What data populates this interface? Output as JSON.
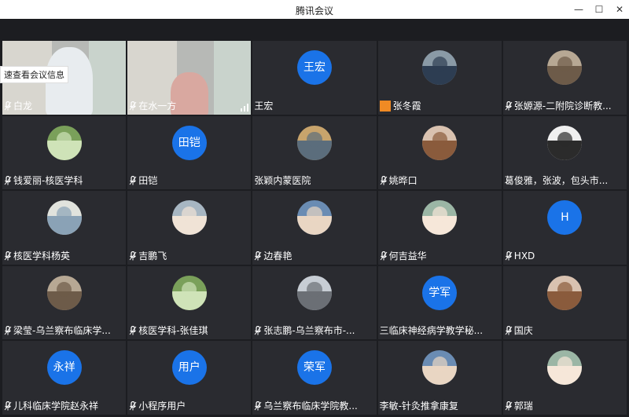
{
  "window": {
    "title": "腾讯会议",
    "min_glyph": "—",
    "max_glyph": "☐",
    "close_glyph": "✕"
  },
  "tooltip": "速查看会议信息",
  "colors": {
    "avatar_blue": "#1a73e8",
    "tile_bg": "#2a2b30",
    "grid_bg": "#1c1d21"
  },
  "participants": [
    {
      "name": "白龙",
      "icon": "mic-icon",
      "kind": "video"
    },
    {
      "name": "在水一方",
      "icon": "mic-icon",
      "kind": "video"
    },
    {
      "name": "王宏",
      "icon": "",
      "kind": "text",
      "avatar_text": "王宏"
    },
    {
      "name": "张冬霞",
      "icon": "person-icon",
      "kind": "photo"
    },
    {
      "name": "张嫄源-二附院诊断教...",
      "icon": "mic-icon",
      "kind": "photo"
    },
    {
      "name": "钱爱丽-核医学科",
      "icon": "mic-icon",
      "kind": "photo"
    },
    {
      "name": "田铠",
      "icon": "mic-icon",
      "kind": "text",
      "avatar_text": "田铠"
    },
    {
      "name": "张颖内蒙医院",
      "icon": "",
      "kind": "photo"
    },
    {
      "name": "姚晔口",
      "icon": "mic-icon",
      "kind": "photo"
    },
    {
      "name": "葛俊雅，张波，包头市...",
      "icon": "",
      "kind": "photo"
    },
    {
      "name": "核医学科杨英",
      "icon": "mic-icon",
      "kind": "photo"
    },
    {
      "name": "吉鹏飞",
      "icon": "mic-icon",
      "kind": "photo"
    },
    {
      "name": "边春艳",
      "icon": "mic-icon",
      "kind": "photo"
    },
    {
      "name": "何吉益华",
      "icon": "mic-icon",
      "kind": "photo"
    },
    {
      "name": "HXD",
      "icon": "mic-icon",
      "kind": "text",
      "avatar_text": "H"
    },
    {
      "name": "梁莹-乌兰察布临床学...",
      "icon": "mic-icon",
      "kind": "photo"
    },
    {
      "name": "核医学科-张佳琪",
      "icon": "mic-icon",
      "kind": "photo"
    },
    {
      "name": "张志鹏-乌兰察布市-...",
      "icon": "mic-icon",
      "kind": "photo"
    },
    {
      "name": "三临床神经病学教学秘...",
      "icon": "",
      "kind": "text",
      "avatar_text": "学军"
    },
    {
      "name": "国庆",
      "icon": "mic-icon",
      "kind": "photo"
    },
    {
      "name": "儿科临床学院赵永祥",
      "icon": "mic-icon",
      "kind": "text",
      "avatar_text": "永祥"
    },
    {
      "name": "小程序用户",
      "icon": "mic-icon",
      "kind": "text",
      "avatar_text": "用户"
    },
    {
      "name": "乌兰察布临床学院教...",
      "icon": "mic-icon",
      "kind": "text",
      "avatar_text": "荣军"
    },
    {
      "name": "李敏-针灸推拿康复",
      "icon": "",
      "kind": "photo"
    },
    {
      "name": "郭瑞",
      "icon": "mic-icon",
      "kind": "photo"
    }
  ]
}
